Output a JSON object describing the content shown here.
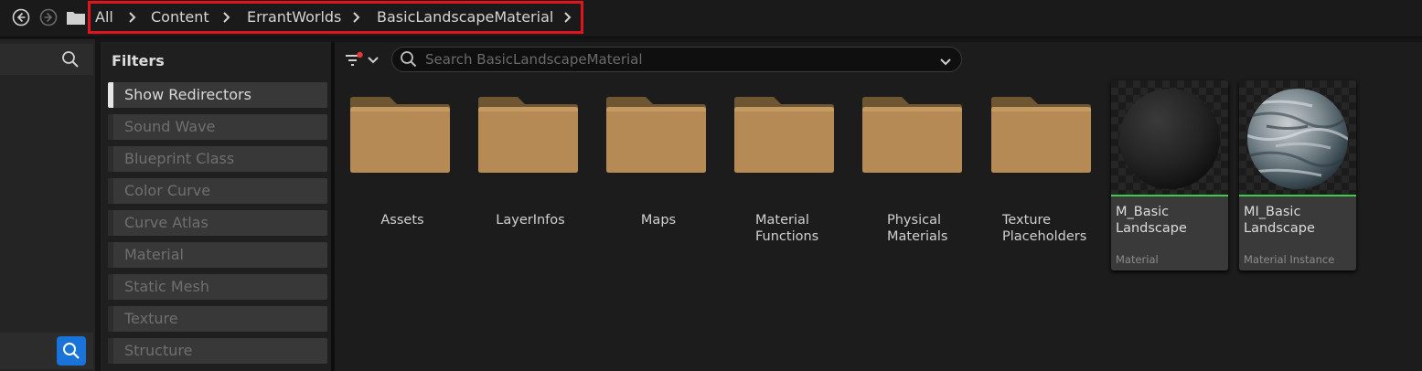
{
  "breadcrumb": [
    "All",
    "Content",
    "ErrantWorlds",
    "BasicLandscapeMaterial"
  ],
  "filters": {
    "title": "Filters",
    "items": [
      {
        "label": "Show Redirectors",
        "active": true
      },
      {
        "label": "Sound Wave",
        "active": false
      },
      {
        "label": "Blueprint Class",
        "active": false
      },
      {
        "label": "Color Curve",
        "active": false
      },
      {
        "label": "Curve Atlas",
        "active": false
      },
      {
        "label": "Material",
        "active": false
      },
      {
        "label": "Static Mesh",
        "active": false
      },
      {
        "label": "Texture",
        "active": false
      },
      {
        "label": "Structure",
        "active": false
      }
    ]
  },
  "search": {
    "placeholder": "Search BasicLandscapeMaterial"
  },
  "folders": [
    {
      "name": "Assets"
    },
    {
      "name": "LayerInfos"
    },
    {
      "name": "Maps"
    },
    {
      "name": "Material\nFunctions"
    },
    {
      "name": "Physical\nMaterials"
    },
    {
      "name": "Texture\nPlaceholders"
    }
  ],
  "assets": [
    {
      "name": "M_Basic\nLandscape",
      "type": "Material",
      "thumbnail": "dark-sphere"
    },
    {
      "name": "MI_Basic\nLandscape",
      "type": "Material Instance",
      "thumbnail": "rock-sphere"
    }
  ],
  "colors": {
    "accent": "#1a73d9",
    "highlight": "#e0141e",
    "folder": "#b58a54",
    "asset_underline": "#3ccb4a",
    "notification_dot": "#e53935"
  }
}
